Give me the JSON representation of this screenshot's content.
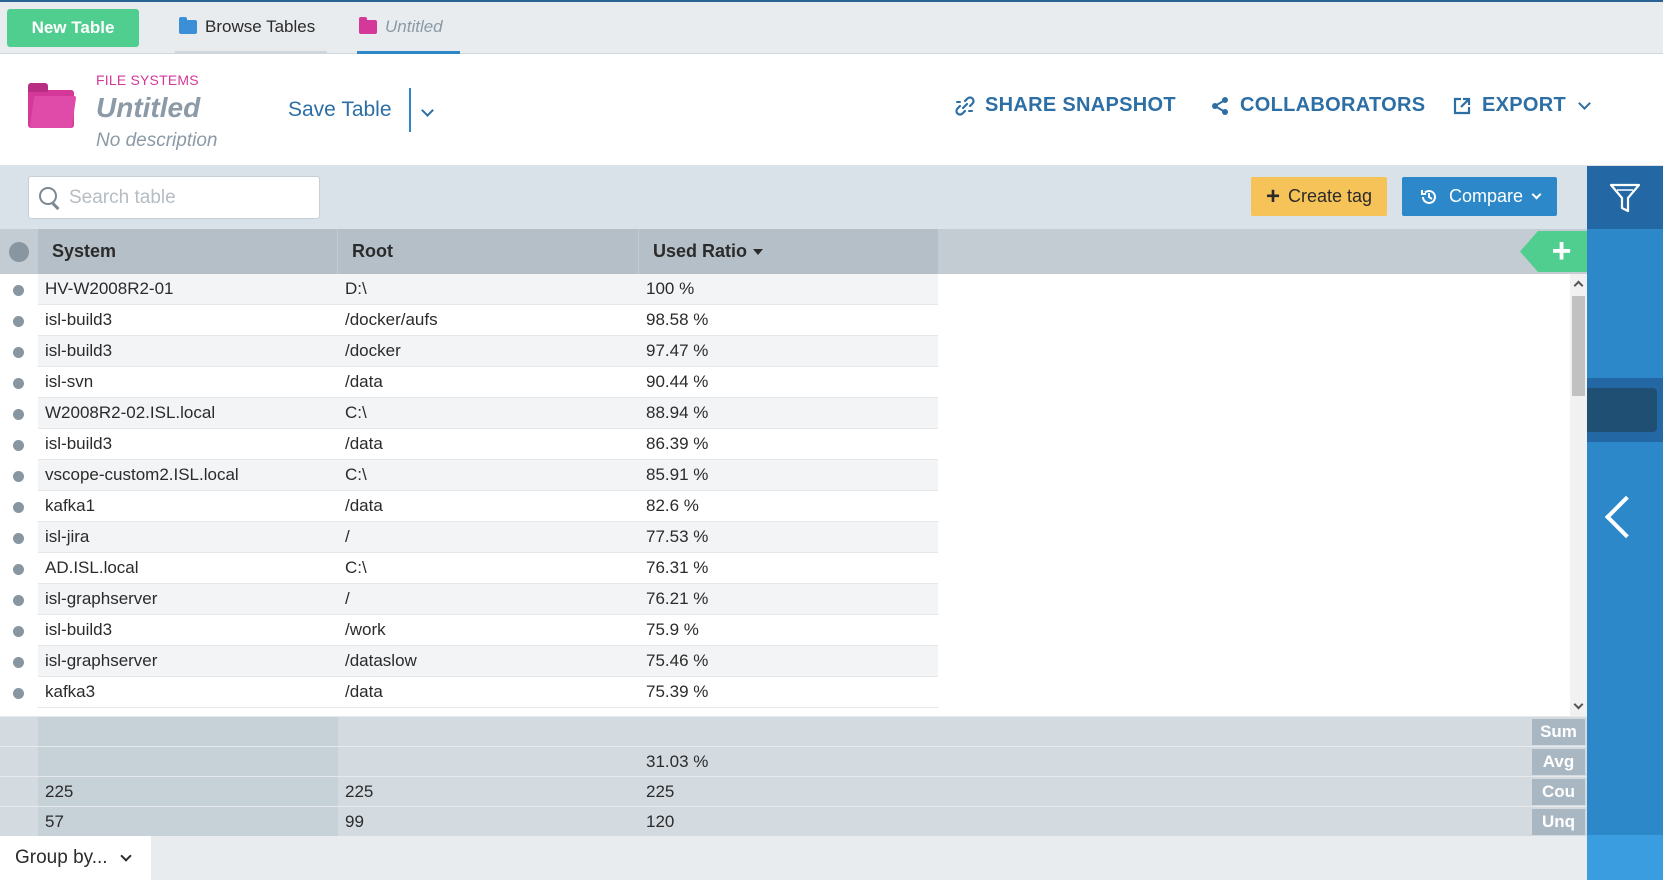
{
  "tabbar": {
    "new_table": "New Table",
    "browse_tables": "Browse Tables",
    "untitled_tab": "Untitled"
  },
  "header": {
    "category": "FILE SYSTEMS",
    "title": "Untitled",
    "description": "No description",
    "save_label": "Save Table",
    "share_snapshot": "SHARE SNAPSHOT",
    "collaborators": "COLLABORATORS",
    "export": "EXPORT"
  },
  "toolbar": {
    "search_placeholder": "Search table",
    "create_tag": "Create tag",
    "compare": "Compare"
  },
  "table": {
    "columns": [
      "System",
      "Root",
      "Used Ratio"
    ],
    "rows": [
      [
        "HV-W2008R2-01",
        "D:\\",
        "100 %"
      ],
      [
        "isl-build3",
        "/docker/aufs",
        "98.58 %"
      ],
      [
        "isl-build3",
        "/docker",
        "97.47 %"
      ],
      [
        "isl-svn",
        "/data",
        "90.44 %"
      ],
      [
        "W2008R2-02.ISL.local",
        "C:\\",
        "88.94 %"
      ],
      [
        "isl-build3",
        "/data",
        "86.39 %"
      ],
      [
        "vscope-custom2.ISL.local",
        "C:\\",
        "85.91 %"
      ],
      [
        "kafka1",
        "/data",
        "82.6 %"
      ],
      [
        "isl-jira",
        "/",
        "77.53 %"
      ],
      [
        "AD.ISL.local",
        "C:\\",
        "76.31 %"
      ],
      [
        "isl-graphserver",
        "/",
        "76.21 %"
      ],
      [
        "isl-build3",
        "/work",
        "75.9 %"
      ],
      [
        "isl-graphserver",
        "/dataslow",
        "75.46 %"
      ],
      [
        "kafka3",
        "/data",
        "75.39 %"
      ]
    ]
  },
  "summary": {
    "sum": {
      "label": "Sum",
      "system": "",
      "root": "",
      "used": ""
    },
    "avg": {
      "label": "Avg",
      "system": "",
      "root": "",
      "used": "31.03 %"
    },
    "count": {
      "label": "Cou",
      "system": "225",
      "root": "225",
      "used": "225"
    },
    "unique": {
      "label": "Unq",
      "system": "57",
      "root": "99",
      "used": "120"
    }
  },
  "footer": {
    "group_by": "Group by..."
  },
  "colors": {
    "accent": "#2d88c9",
    "brand_pink": "#d4399a",
    "new_button": "#4fce8f",
    "tag_button": "#f6c358"
  }
}
